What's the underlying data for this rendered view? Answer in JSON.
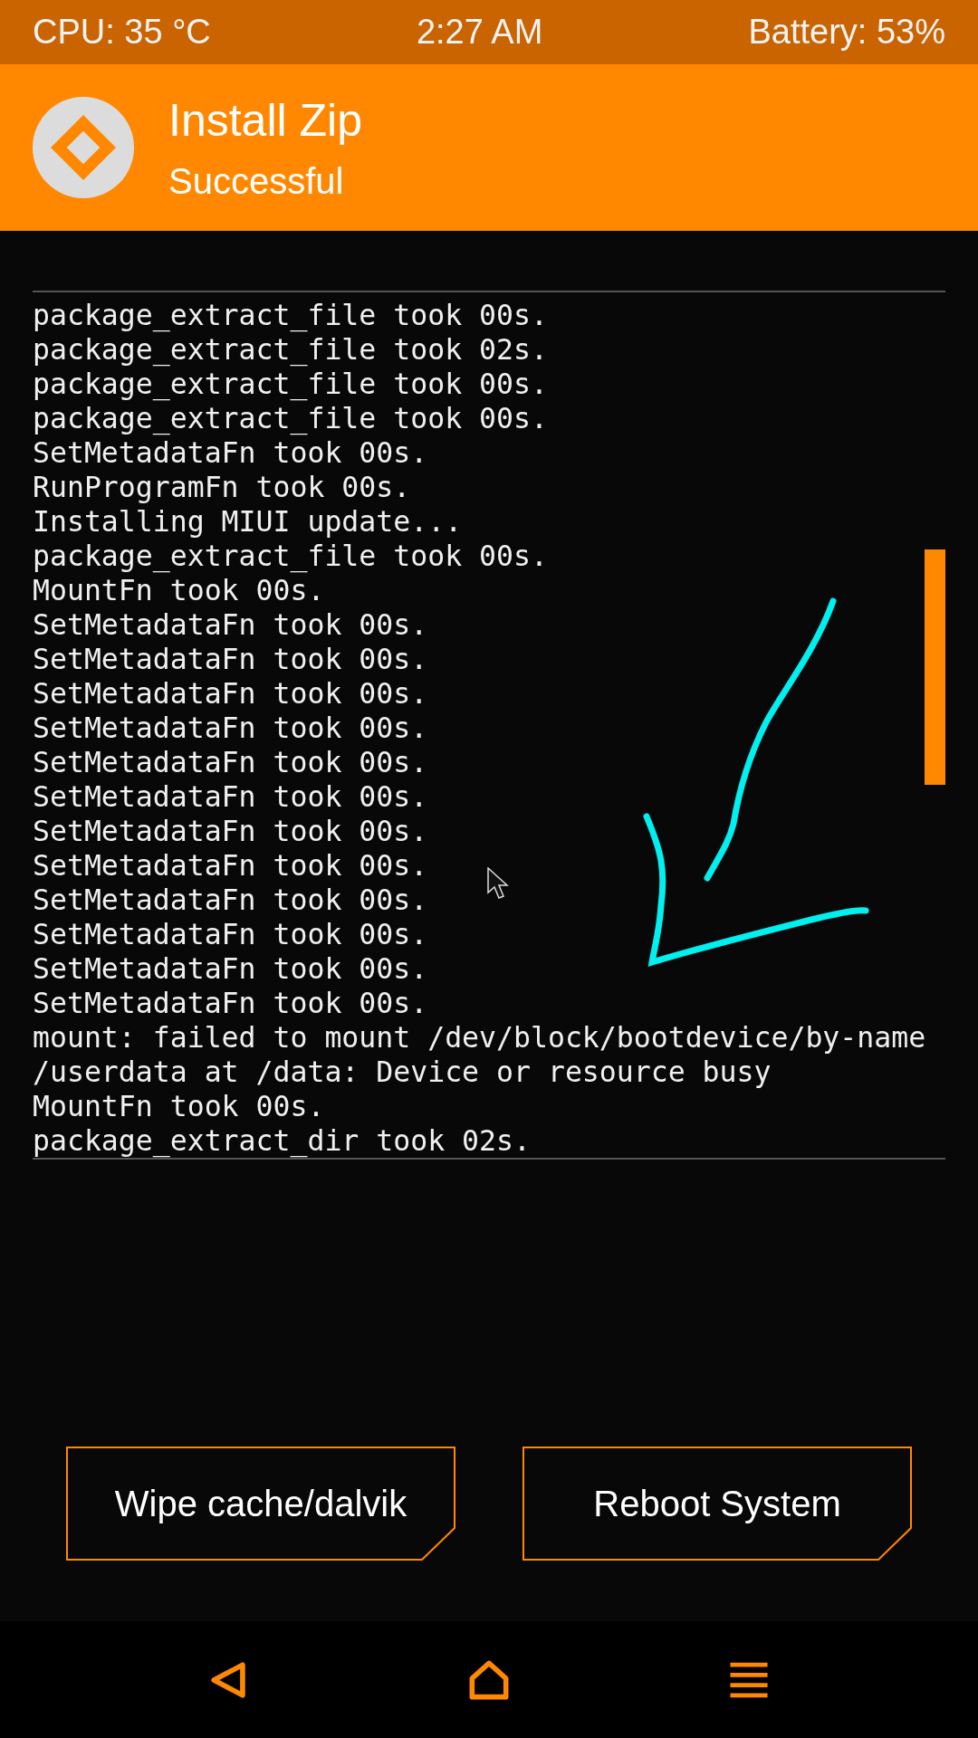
{
  "status_bar": {
    "cpu": "CPU: 35 °C",
    "time": "2:27 AM",
    "battery": "Battery: 53%"
  },
  "header": {
    "title": "Install Zip",
    "subtitle": "Successful"
  },
  "log": [
    "package_extract_file took 00s.",
    "package_extract_file took 02s.",
    "package_extract_file took 00s.",
    "package_extract_file took 00s.",
    "SetMetadataFn took 00s.",
    "RunProgramFn took 00s.",
    "Installing MIUI update...",
    "package_extract_file took 00s.",
    "MountFn took 00s.",
    "SetMetadataFn took 00s.",
    "SetMetadataFn took 00s.",
    "SetMetadataFn took 00s.",
    "SetMetadataFn took 00s.",
    "SetMetadataFn took 00s.",
    "SetMetadataFn took 00s.",
    "SetMetadataFn took 00s.",
    "SetMetadataFn took 00s.",
    "SetMetadataFn took 00s.",
    "SetMetadataFn took 00s.",
    "SetMetadataFn took 00s.",
    "SetMetadataFn took 00s.",
    "mount: failed to mount /dev/block/bootdevice/by-name",
    "/userdata at /data: Device or resource busy",
    "MountFn took 00s.",
    "package_extract_dir took 02s."
  ],
  "buttons": [
    "Wipe cache/dalvik",
    "Reboot System"
  ]
}
